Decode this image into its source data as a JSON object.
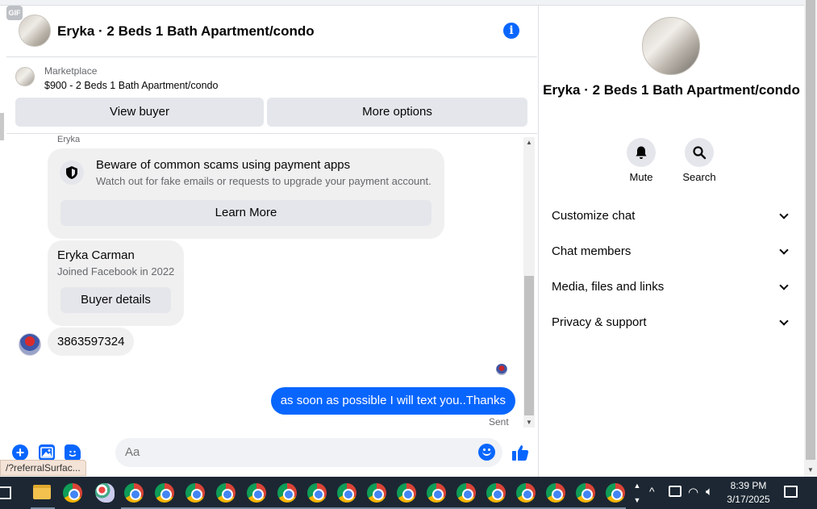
{
  "chat": {
    "title": "Eryka · 2 Beds 1 Bath Apartment/condo",
    "marketplace_label": "Marketplace",
    "listing": "$900 - 2 Beds 1 Bath Apartment/condo",
    "view_buyer_label": "View buyer",
    "more_options_label": "More options"
  },
  "messages": {
    "sender_name": "Eryka",
    "scam_title": "Beware of common scams using payment apps",
    "scam_body": "Watch out for fake emails or requests to upgrade your payment account.",
    "learn_more_label": "Learn More",
    "buyer_name": "Eryka Carman",
    "buyer_joined": "Joined Facebook in 2022",
    "buyer_details_label": "Buyer details",
    "incoming_text": "3863597324",
    "outgoing_text": "as soon as possible I will text you..Thanks",
    "status": "Sent"
  },
  "composer": {
    "placeholder": "Aa",
    "gif_label": "GIF"
  },
  "details": {
    "title": "Eryka · 2 Beds 1 Bath Apartment/condo",
    "actions": [
      {
        "label": "Mute",
        "icon": "bell-icon"
      },
      {
        "label": "Search",
        "icon": "search-icon"
      }
    ],
    "sections": [
      {
        "label": "Customize chat"
      },
      {
        "label": "Chat members"
      },
      {
        "label": "Media, files and links"
      },
      {
        "label": "Privacy & support"
      }
    ]
  },
  "status_tooltip": "/?referralSurfac...",
  "taskbar": {
    "time": "8:39 PM",
    "date": "3/17/2025"
  },
  "colors": {
    "accent": "#0866ff",
    "bubble_gray": "#f0f0f0",
    "button_gray": "#e4e6eb",
    "taskbar": "#1c2733"
  }
}
